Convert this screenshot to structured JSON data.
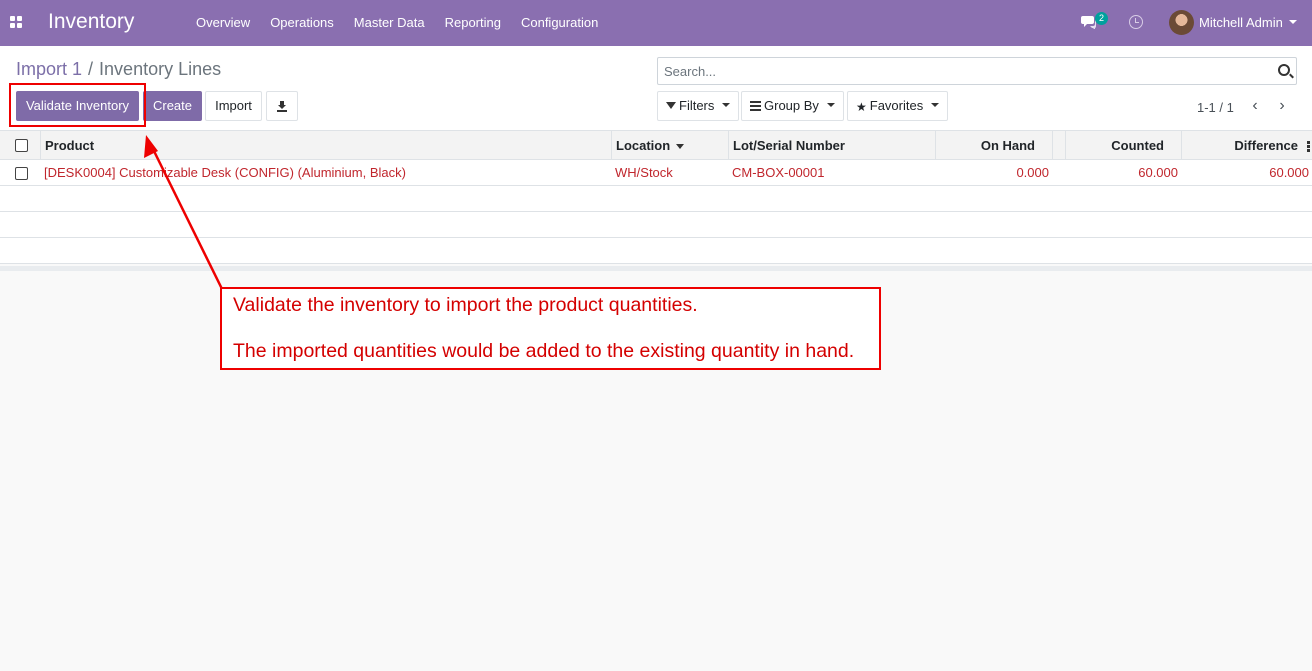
{
  "navbar": {
    "app_name": "Inventory",
    "menu": [
      "Overview",
      "Operations",
      "Master Data",
      "Reporting",
      "Configuration"
    ],
    "message_count": "2",
    "user_name": "Mitchell Admin",
    "brand_color": "#8a6fb0"
  },
  "breadcrumb": {
    "parent": "Import 1",
    "separator": "/",
    "current": "Inventory Lines"
  },
  "buttons": {
    "validate": "Validate Inventory",
    "create": "Create",
    "import": "Import"
  },
  "search": {
    "placeholder": "Search..."
  },
  "filters": {
    "filters": "Filters",
    "group_by": "Group By",
    "favorites": "Favorites"
  },
  "pager": {
    "range": "1-1 / 1",
    "prev": "‹",
    "next": "›"
  },
  "table": {
    "columns": {
      "product": "Product",
      "location": "Location",
      "lot": "Lot/Serial Number",
      "on_hand": "On Hand",
      "counted": "Counted",
      "difference": "Difference"
    },
    "rows": [
      {
        "product": "[DESK0004] Customizable Desk (CONFIG) (Aluminium, Black)",
        "location": "WH/Stock",
        "lot": "CM-BOX-00001",
        "on_hand": "0.000",
        "counted": "60.000",
        "difference": "60.000"
      }
    ],
    "row_text_color": "#c0262d"
  },
  "annotation": {
    "line1": "Validate the inventory to import the product quantities.",
    "line2": "The imported quantities would be added to the existing quantity in hand.",
    "color": "#ee0000"
  }
}
